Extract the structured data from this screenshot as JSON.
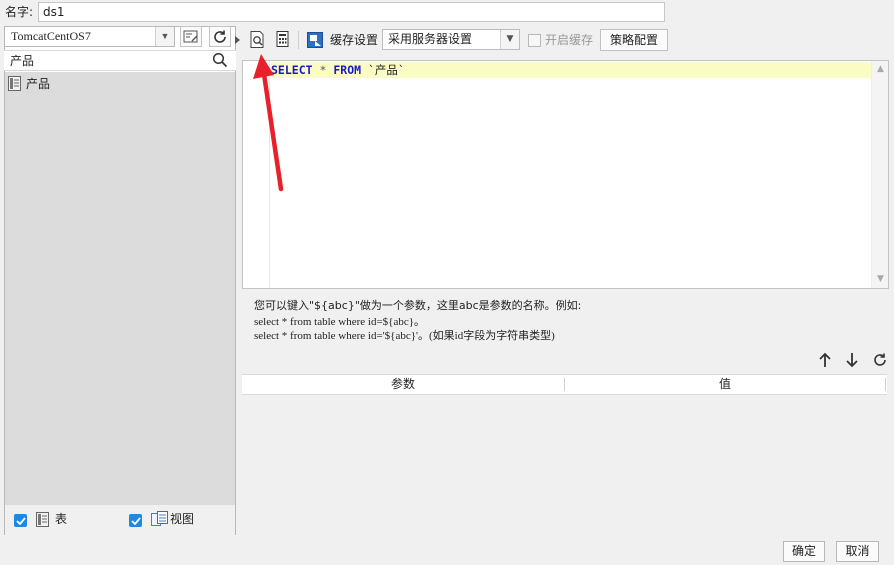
{
  "name_row": {
    "label": "名字:",
    "value": "ds1"
  },
  "connection": {
    "selected": "TomcatCentOS7"
  },
  "table_search": {
    "value": "产品"
  },
  "tables": [
    {
      "label": "产品"
    }
  ],
  "left_footer": {
    "table_label": "表",
    "view_label": "视图",
    "table_checked": true,
    "view_checked": true
  },
  "toolbar": {
    "cache_settings_label": "缓存设置",
    "cache_mode": "采用服务器设置",
    "enable_cache_label": "开启缓存",
    "strategy_label": "策略配置"
  },
  "sql": {
    "line1": "SELECT * FROM `产品`"
  },
  "hints": {
    "line1": "您可以键入\"${abc}\"做为一个参数，这里abc是参数的名称。例如:",
    "line2": "select * from table where id=${abc}。",
    "line3": "select * from table where id='${abc}'。(如果id字段为字符串类型)"
  },
  "param_table": {
    "columns": [
      "参数",
      "值"
    ]
  },
  "buttons": {
    "ok": "确定",
    "cancel": "取消"
  },
  "colors": {
    "accent": "#1e88e5",
    "annotation": "#e8202a",
    "keyword": "#1919c8",
    "line_highlight": "#fbfbc4"
  }
}
